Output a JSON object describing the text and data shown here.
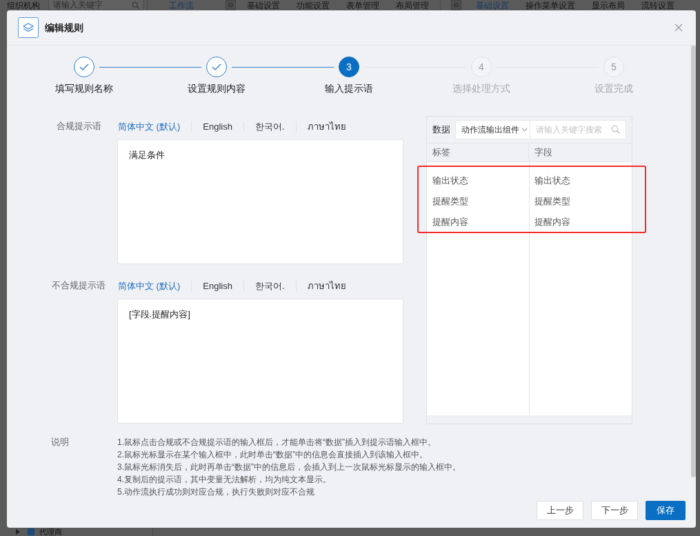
{
  "background_page": {
    "sidebar_title": "组织机构",
    "search": {
      "placeholder": "请输入关键字"
    },
    "tabs": [
      {
        "label": "工作流",
        "selected": true
      }
    ],
    "toolbar_left": [
      {
        "label": "基础设置",
        "selected": false
      },
      {
        "label": "功能设置",
        "selected": false
      },
      {
        "label": "表单管理",
        "selected": false
      },
      {
        "label": "布局管理",
        "selected": false
      }
    ],
    "toolbar_right": [
      {
        "label": "基础设置",
        "selected": true
      },
      {
        "label": "操作菜单设置",
        "selected": false
      },
      {
        "label": "显示布局",
        "selected": false
      },
      {
        "label": "流转设置",
        "selected": false
      }
    ],
    "tree_item": "代理商"
  },
  "dialog": {
    "title": "编辑规则"
  },
  "steps": [
    {
      "label": "填写规则名称",
      "completed": true,
      "selected": false
    },
    {
      "label": "设置规则内容",
      "completed": true,
      "selected": false
    },
    {
      "number": "3",
      "label": "输入提示语",
      "completed": false,
      "selected": true
    },
    {
      "number": "4",
      "label": "选择处理方式",
      "completed": false,
      "selected": false
    },
    {
      "number": "5",
      "label": "设置完成",
      "completed": false,
      "selected": false
    }
  ],
  "compliant_prompt": {
    "label": "合规提示语",
    "languages": [
      {
        "label": "简体中文 (默认)",
        "selected": true
      },
      {
        "label": "English",
        "selected": false
      },
      {
        "label": "한국어.",
        "selected": false
      },
      {
        "label": "ภาษาไทย",
        "selected": false
      }
    ],
    "value": "满足条件"
  },
  "noncompliant_prompt": {
    "label": "不合规提示语",
    "languages": [
      {
        "label": "简体中文 (默认)",
        "selected": true
      },
      {
        "label": "English",
        "selected": false
      },
      {
        "label": "한국어.",
        "selected": false
      },
      {
        "label": "ภาษาไทย",
        "selected": false
      }
    ],
    "value": "[字段.提醒内容]"
  },
  "data_panel": {
    "label": "数据",
    "source": "动作流输出组件",
    "search": {
      "placeholder": "请输入关键字搜索"
    },
    "columns": [
      "标签",
      "字段"
    ],
    "rows": [
      {
        "label": "输出状态",
        "field": "输出状态"
      },
      {
        "label": "提醒类型",
        "field": "提醒类型"
      },
      {
        "label": "提醒内容",
        "field": "提醒内容"
      }
    ],
    "highlighted": true
  },
  "notes": {
    "label": "说明",
    "lines": [
      "1.鼠标点击合规或不合规提示语的输入框后，才能单击将“数据”插入到提示语输入框中。",
      "2.鼠标光标显示在某个输入框中，此时单击“数据”中的信息会直接插入到该输入框中。",
      "3.鼠标光标消失后，此时再单击“数据”中的信息后，会插入到上一次鼠标光标显示的输入框中。",
      "4.复制后的提示语，其中变量无法解析，均为纯文本显示。",
      "5.动作流执行成功则对应合规，执行失败则对应不合规"
    ]
  },
  "buttons": [
    {
      "label": "上一步",
      "kind": "secondary"
    },
    {
      "label": "下一步",
      "kind": "secondary"
    },
    {
      "label": "保存",
      "kind": "primary"
    }
  ]
}
